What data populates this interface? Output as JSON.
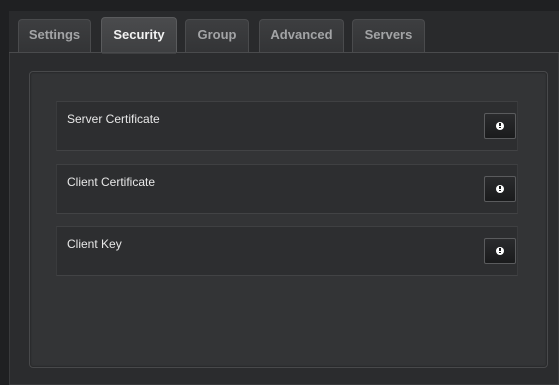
{
  "tabs": [
    {
      "label": "Settings",
      "active": false
    },
    {
      "label": "Security",
      "active": true
    },
    {
      "label": "Group",
      "active": false
    },
    {
      "label": "Advanced",
      "active": false
    },
    {
      "label": "Servers",
      "active": false
    }
  ],
  "security": {
    "items": [
      {
        "label": "Server Certificate",
        "button_icon": "info-icon"
      },
      {
        "label": "Client Certificate",
        "button_icon": "info-icon"
      },
      {
        "label": "Client Key",
        "button_icon": "info-icon"
      }
    ]
  },
  "colors": {
    "background": "#1f2022",
    "panel": "#333436",
    "active_tab_text": "#f2f2f2",
    "inactive_tab_text": "#a3a4a6"
  }
}
